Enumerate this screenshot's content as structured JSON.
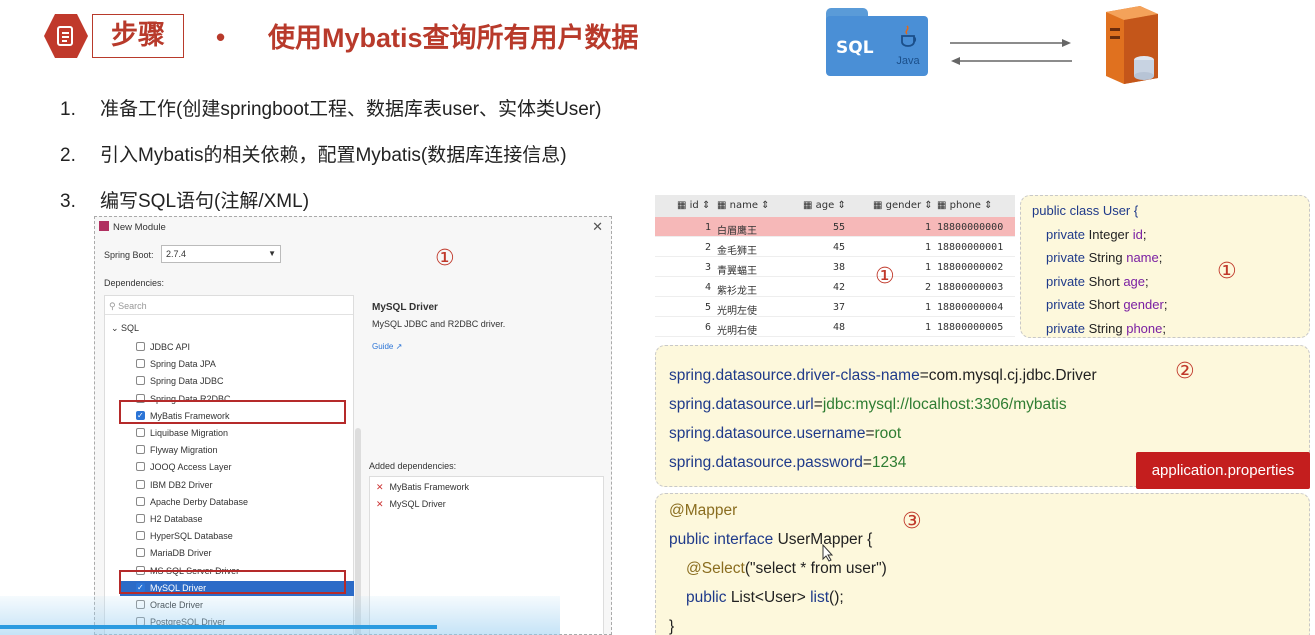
{
  "header": {
    "section_label": "步骤",
    "bullet": "•",
    "title": "使用Mybatis查询所有用户数据",
    "diagram": {
      "folder_label": "SQL",
      "java_label": "Java"
    }
  },
  "steps": [
    {
      "num": "1.",
      "text": "准备工作(创建springboot工程、数据库表user、实体类User)"
    },
    {
      "num": "2.",
      "text": "引入Mybatis的相关依赖，配置Mybatis(数据库连接信息)"
    },
    {
      "num": "3.",
      "text": "编写SQL语句(注解/XML)"
    }
  ],
  "markers": {
    "one": "①",
    "two": "②",
    "three": "③"
  },
  "dialog": {
    "title": "New Module",
    "close": "✕",
    "spring_boot_label": "Spring Boot:",
    "spring_boot_value": "2.7.4",
    "dependencies_label": "Dependencies:",
    "search_placeholder": "Search",
    "group": "SQL",
    "items": [
      {
        "label": "JDBC API",
        "checked": false
      },
      {
        "label": "Spring Data JPA",
        "checked": false
      },
      {
        "label": "Spring Data JDBC",
        "checked": false
      },
      {
        "label": "Spring Data R2DBC",
        "checked": false
      },
      {
        "label": "MyBatis Framework",
        "checked": true
      },
      {
        "label": "Liquibase Migration",
        "checked": false
      },
      {
        "label": "Flyway Migration",
        "checked": false
      },
      {
        "label": "JOOQ Access Layer",
        "checked": false
      },
      {
        "label": "IBM DB2 Driver",
        "checked": false
      },
      {
        "label": "Apache Derby Database",
        "checked": false
      },
      {
        "label": "H2 Database",
        "checked": false
      },
      {
        "label": "HyperSQL Database",
        "checked": false
      },
      {
        "label": "MariaDB Driver",
        "checked": false
      },
      {
        "label": "MS SQL Server Driver",
        "checked": false
      },
      {
        "label": "MySQL Driver",
        "checked": true
      },
      {
        "label": "Oracle Driver",
        "checked": false
      },
      {
        "label": "PostgreSQL Driver",
        "checked": false
      }
    ],
    "info_title": "MySQL Driver",
    "info_desc": "MySQL JDBC and R2DBC driver.",
    "info_guide": "Guide ↗",
    "added_label": "Added dependencies:",
    "added": [
      "MyBatis Framework",
      "MySQL Driver"
    ]
  },
  "table": {
    "headers": [
      "id",
      "name",
      "age",
      "gender",
      "phone"
    ],
    "rows": [
      [
        "1",
        "白眉鹰王",
        "55",
        "1",
        "18800000000"
      ],
      [
        "2",
        "金毛狮王",
        "45",
        "1",
        "18800000001"
      ],
      [
        "3",
        "青翼蝠王",
        "38",
        "1",
        "18800000002"
      ],
      [
        "4",
        "紫衫龙王",
        "42",
        "2",
        "18800000003"
      ],
      [
        "5",
        "光明左使",
        "37",
        "1",
        "18800000004"
      ],
      [
        "6",
        "光明右使",
        "48",
        "1",
        "18800000005"
      ]
    ]
  },
  "entity_code": {
    "l1a": "public class ",
    "l1b": "User {",
    "fields": [
      {
        "kw": "private ",
        "type": "Integer ",
        "name": "id",
        "end": ";"
      },
      {
        "kw": "private ",
        "type": "String ",
        "name": "name",
        "end": ";"
      },
      {
        "kw": "private ",
        "type": "Short ",
        "name": "age",
        "end": ";"
      },
      {
        "kw": "private ",
        "type": "Short ",
        "name": "gender",
        "end": ";"
      },
      {
        "kw": "private ",
        "type": "String ",
        "name": "phone",
        "end": ";"
      }
    ]
  },
  "properties": {
    "lines": [
      {
        "key": "spring.datasource.driver-class-name",
        "eq": "=",
        "val": "com.mysql.cj.jdbc.Driver"
      },
      {
        "key": "spring.datasource.url",
        "eq": "=",
        "val": "jdbc:mysql://localhost:3306/mybatis"
      },
      {
        "key": "spring.datasource.username",
        "eq": "=",
        "val": "root"
      },
      {
        "key": "spring.datasource.password",
        "eq": "=",
        "val": "1234"
      }
    ],
    "file_badge": "application.properties"
  },
  "mapper_code": {
    "annotation": "@Mapper",
    "l2a": "public interface ",
    "l2b": "UserMapper {",
    "select_ann": "@Select",
    "select_args": "(\"select  * from user\")",
    "l4a": "public ",
    "l4b": "List<User> ",
    "l4c": "list",
    "l4d": "();",
    "close": "}"
  },
  "colors": {
    "accent": "#b83a2b",
    "badge": "#c41e1e",
    "panel": "#fdf8dc",
    "selected": "#2c6bc7"
  }
}
